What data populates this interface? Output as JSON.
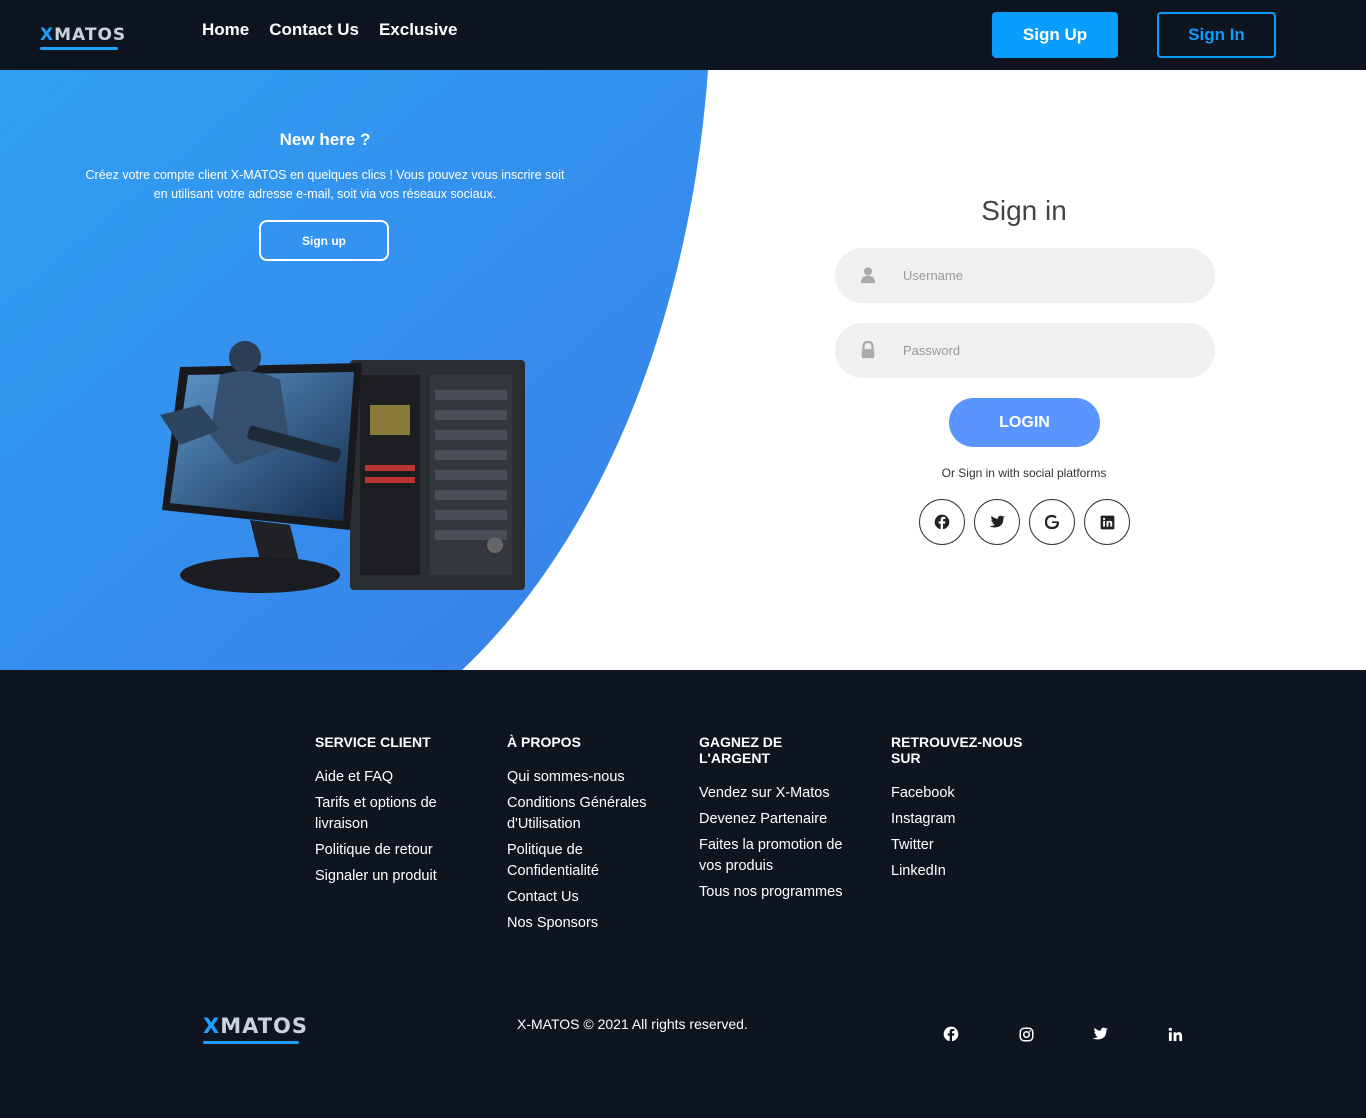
{
  "brand": {
    "name": "XMATOS",
    "x": "X",
    "rest": "MATOS",
    "accent": "#099dfd"
  },
  "nav": {
    "links": [
      "Home",
      "Contact Us",
      "Exclusive"
    ],
    "signup": "Sign Up",
    "signin": "Sign In"
  },
  "hero": {
    "title": "New here ?",
    "text": "Créez votre compte client X-MATOS en quelques clics ! Vous pouvez vous inscrire soit en utilisant votre adresse e-mail, soit via vos réseaux sociaux.",
    "signup": "Sign up"
  },
  "signin": {
    "title": "Sign in",
    "username_placeholder": "Username",
    "password_placeholder": "Password",
    "login": "LOGIN",
    "social_text": "Or Sign in with social platforms",
    "social_icons": [
      "facebook-icon",
      "twitter-icon",
      "google-icon",
      "linkedin-icon"
    ]
  },
  "footer": {
    "columns": [
      {
        "title": "SERVICE CLIENT",
        "links": [
          "Aide et FAQ",
          "Tarifs et options de livraison",
          "Politique de retour",
          "Signaler un produit"
        ]
      },
      {
        "title": "À PROPOS",
        "links": [
          "Qui sommes-nous",
          "Conditions Générales d'Utilisation",
          "Politique de Confidentialité",
          "Contact Us",
          "Nos Sponsors"
        ]
      },
      {
        "title": "GAGNEZ DE L'ARGENT",
        "links": [
          "Vendez sur X-Matos",
          "Devenez Partenaire",
          "Faites la promotion de vos produis",
          "Tous nos programmes"
        ]
      },
      {
        "title": "RETROUVEZ-NOUS SUR",
        "links": [
          "Facebook",
          "Instagram",
          "Twitter",
          "LinkedIn"
        ]
      }
    ],
    "copyright": "X-MATOS © 2021 All rights reserved.",
    "social_icons": [
      "facebook-icon",
      "instagram-icon",
      "twitter-icon",
      "linkedin-icon"
    ]
  }
}
